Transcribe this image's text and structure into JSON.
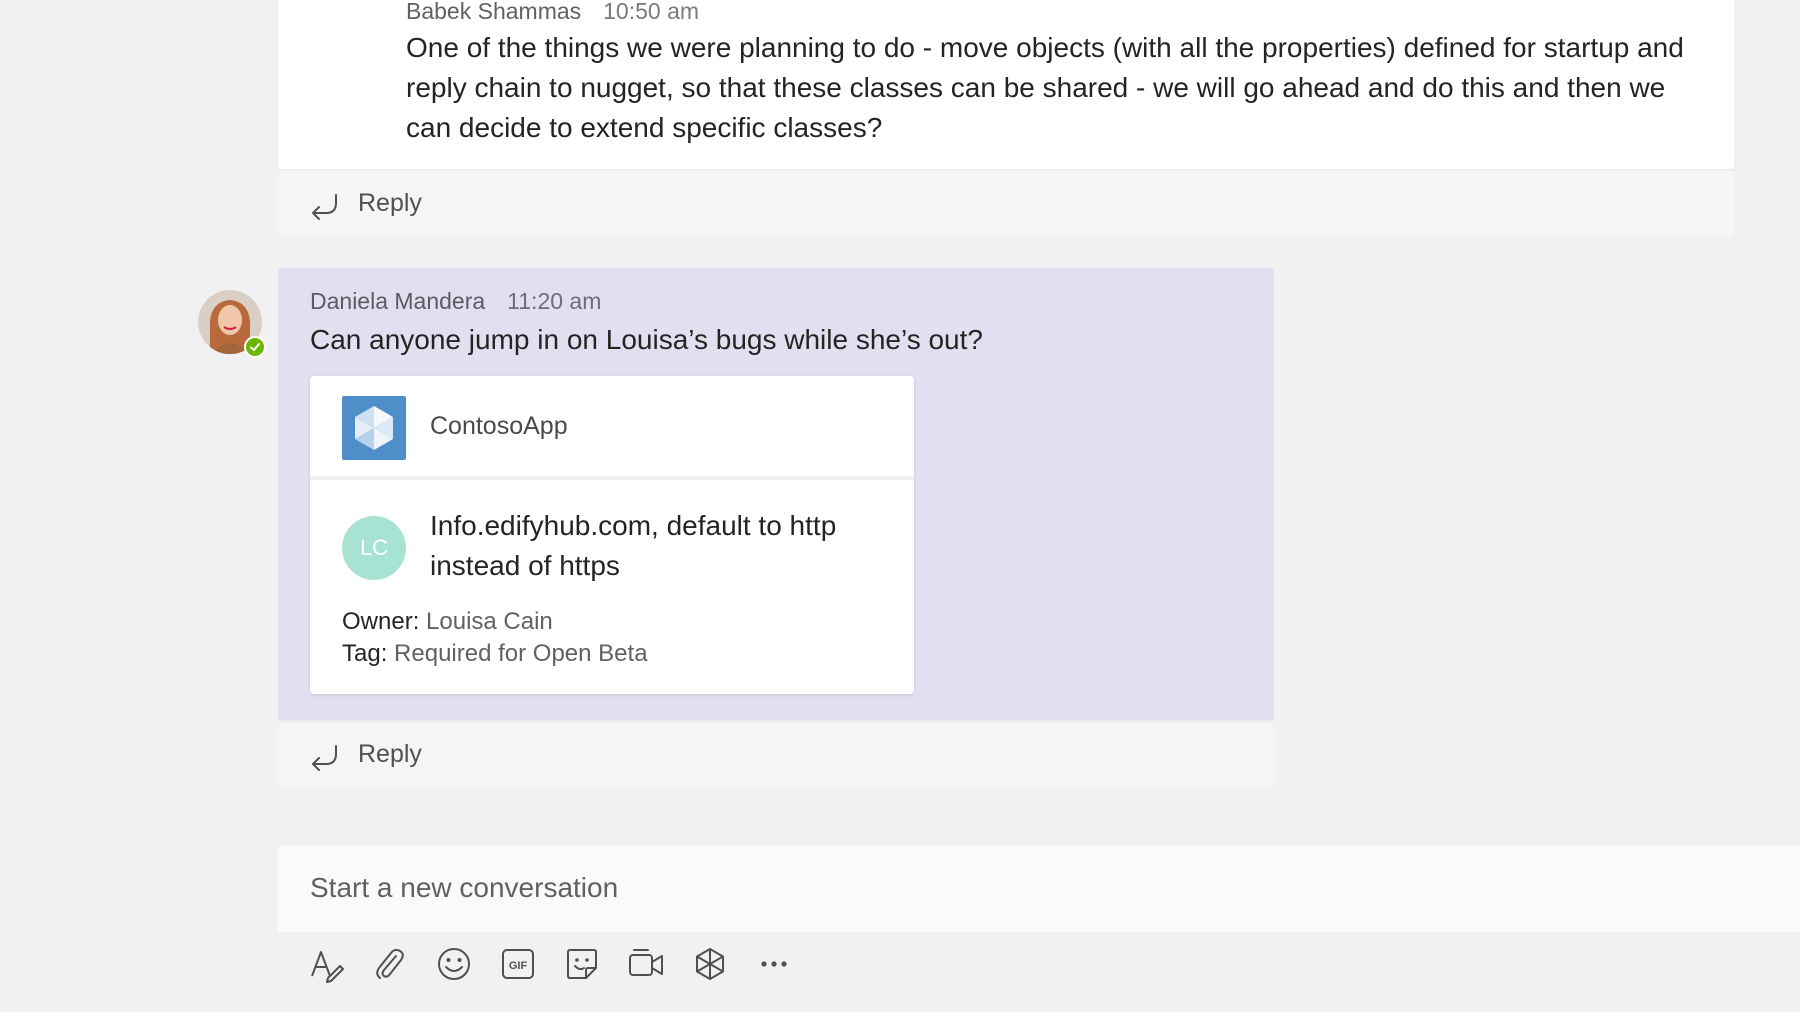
{
  "thread": {
    "messages": [
      {
        "author": "Babek Shammas",
        "time": "10:50 am",
        "text": "One of the things we were planning to do - move objects (with all the properties) defined for startup and reply chain to nugget, so that these classes can be shared - we will go ahead and do this and then we can decide to extend specific classes?",
        "reply_label": "Reply",
        "presence": "available"
      },
      {
        "author": "Daniela Mandera",
        "time": "11:20 am",
        "text": "Can anyone jump in on Louisa’s bugs while she’s out?",
        "reply_label": "Reply",
        "presence": "available",
        "card": {
          "app_name": "ContosoApp",
          "assignee_initials": "LC",
          "title": "Info.edifyhub.com, default to http instead of https",
          "owner_label": "Owner:",
          "owner_value": "Louisa Cain",
          "tag_label": "Tag:",
          "tag_value": "Required for Open Beta"
        }
      }
    ]
  },
  "compose": {
    "placeholder": "Start a new conversation",
    "tools": [
      "format-icon",
      "attach-icon",
      "emoji-icon",
      "gif-icon",
      "sticker-icon",
      "meet-now-icon",
      "contoso-app-icon",
      "more-options-icon"
    ]
  },
  "colors": {
    "presence_available": "#6bb700",
    "highlight_message": "#e0e0f0",
    "assignee_avatar": "#a7e3d3",
    "app_logo": "#4f8fc9"
  }
}
